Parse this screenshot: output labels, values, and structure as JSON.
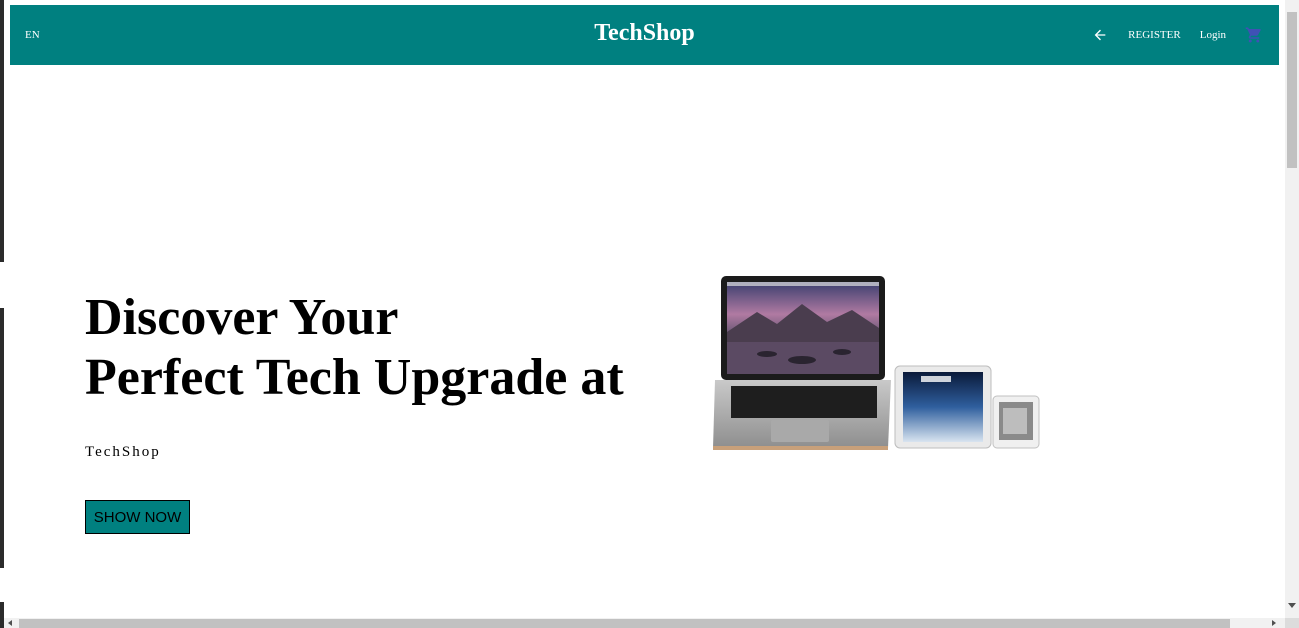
{
  "navbar": {
    "language": "EN",
    "brand": "TechShop",
    "back_icon": "arrow-left-icon",
    "register_label": "REGISTER",
    "login_label": "Login",
    "cart_icon": "shopping-cart-icon",
    "background_color": "#008080",
    "cart_icon_color": "#3f51b5"
  },
  "hero": {
    "title_line1": "Discover Your",
    "title_line2": "Perfect Tech Upgrade at",
    "subtitle": "TechShop",
    "button_label": "SHOW NOW",
    "image_alt": "laptop, tablet and phone devices",
    "accent_color": "#008080"
  }
}
